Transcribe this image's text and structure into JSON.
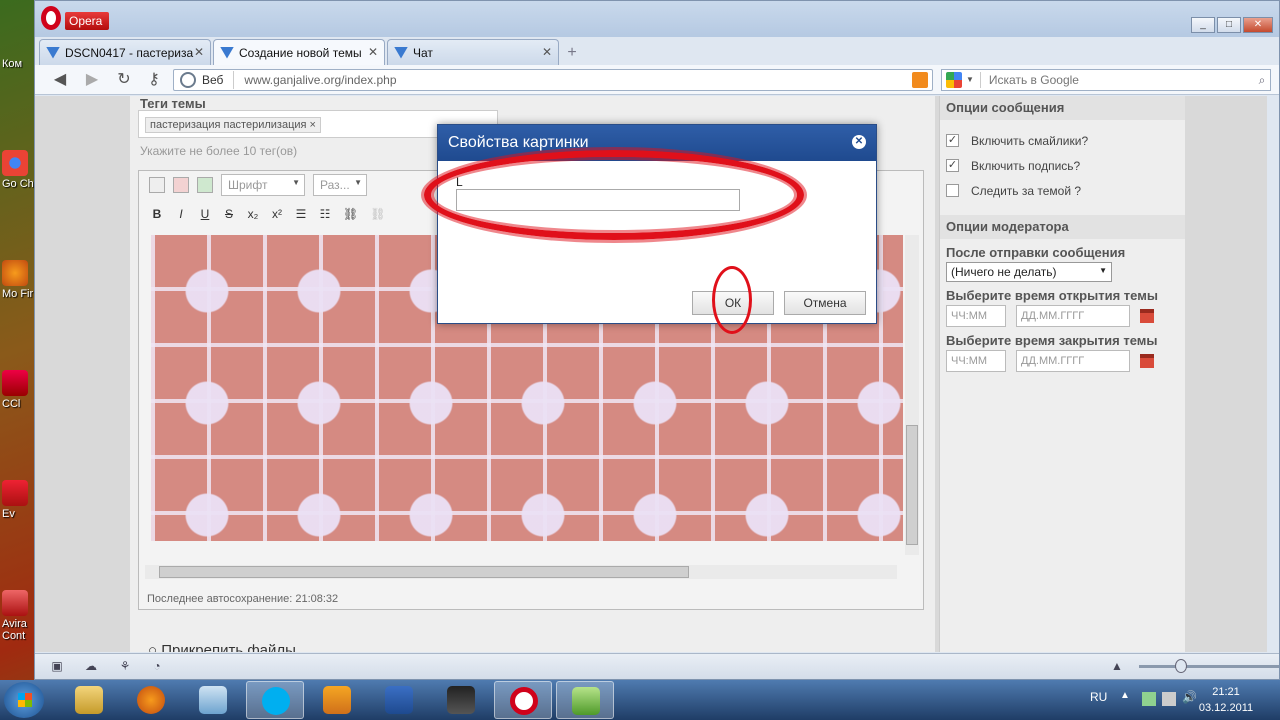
{
  "desktop": {
    "icons": [
      {
        "label": "Ком"
      },
      {
        "label": "Go Ch"
      },
      {
        "label": "Mo Fir"
      },
      {
        "label": "CCl"
      },
      {
        "label": "Ev"
      },
      {
        "label": "Avira Cont"
      }
    ]
  },
  "browser": {
    "menu_label": "Opera",
    "tabs": [
      {
        "label": "DSCN0417 - пастериза"
      },
      {
        "label": "Создание новой темы"
      },
      {
        "label": "Чат"
      }
    ],
    "address": {
      "scope_label": "Веб",
      "url": "www.ganjalive.org/index.php"
    },
    "search": {
      "placeholder": "Искать в Google"
    }
  },
  "page": {
    "tags_label": "Теги темы",
    "tag_chip": "пастеризация пастерилизация",
    "tags_hint": "Укажите не более 10 тег(ов)",
    "editor": {
      "font_select": "Шрифт",
      "size_select": "Раз...",
      "format_buttons": [
        "B",
        "I",
        "U",
        "S",
        "x₂",
        "x²"
      ],
      "autosave": "Последнее автосохранение: 21:08:32"
    },
    "attach_label": "Прикрепить файлы",
    "sidebar": {
      "message_options_title": "Опции сообщения",
      "checks": [
        {
          "label": "Включить смайлики?",
          "checked": true
        },
        {
          "label": "Включить подпись?",
          "checked": true
        },
        {
          "label": "Следить за темой ?",
          "checked": false
        }
      ],
      "moderator_title": "Опции модератора",
      "after_post_label": "После отправки сообщения",
      "after_post_value": "(Ничего не делать)",
      "open_time_label": "Выберите время открытия темы",
      "close_time_label": "Выберите время закрытия темы",
      "time_placeholder": "ЧЧ:ММ",
      "date_placeholder": "ДД.ММ.ГГГГ"
    }
  },
  "dialog": {
    "title": "Свойства картинки",
    "url_label": "L",
    "ok_label": "ОК",
    "cancel_label": "Отмена",
    "annotation_color": "#e0101a"
  },
  "taskbar": {
    "lang": "RU",
    "time": "21:21",
    "date": "03.12.2011"
  }
}
